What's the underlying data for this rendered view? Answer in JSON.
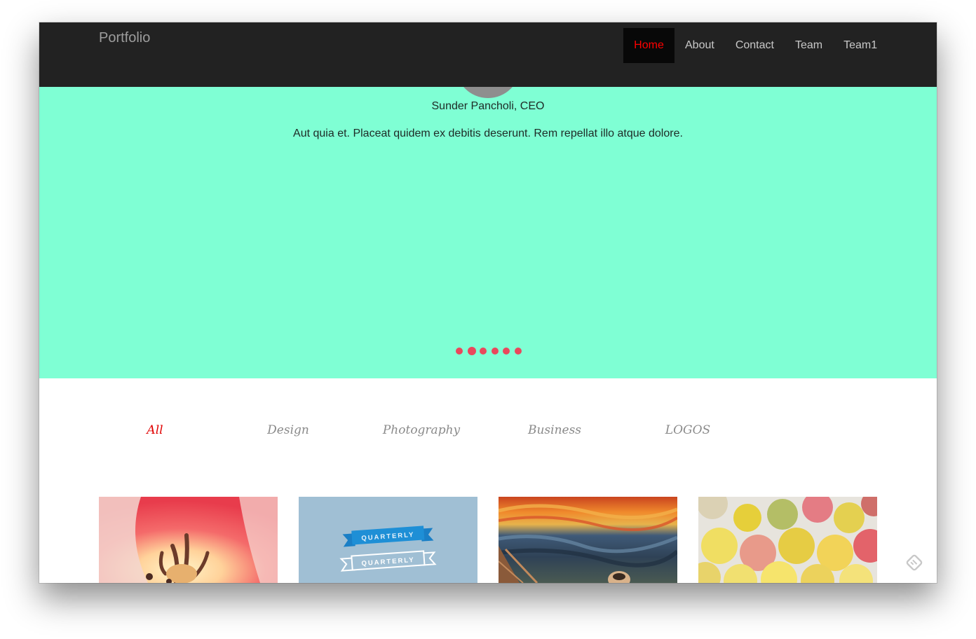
{
  "navbar": {
    "brand": "Portfolio",
    "items": [
      {
        "label": "Home",
        "active": true
      },
      {
        "label": "About"
      },
      {
        "label": "Contact"
      },
      {
        "label": "Team"
      },
      {
        "label": "Team1"
      }
    ]
  },
  "hero": {
    "background_color": "#7fffd4",
    "person": "Sunder Pancholi, CEO",
    "quote": "Aut quia et. Placeat quidem ex debitis deserunt. Rem repellat illo atque dolore.",
    "slide_count": 6,
    "active_slide": 2,
    "dot_color": "#e9485c"
  },
  "filters": {
    "items": [
      "All",
      "Design",
      "Photography",
      "Business",
      "LOGOS"
    ],
    "active": "All",
    "active_color": "#e00000"
  },
  "gallery": {
    "tiles": [
      {
        "name": "tulip-photo"
      },
      {
        "name": "quarterly-logo",
        "banner_text": "QUARTERLY"
      },
      {
        "name": "scream-painting"
      },
      {
        "name": "candy-photo"
      }
    ]
  },
  "corner_icon": "feedly-icon"
}
